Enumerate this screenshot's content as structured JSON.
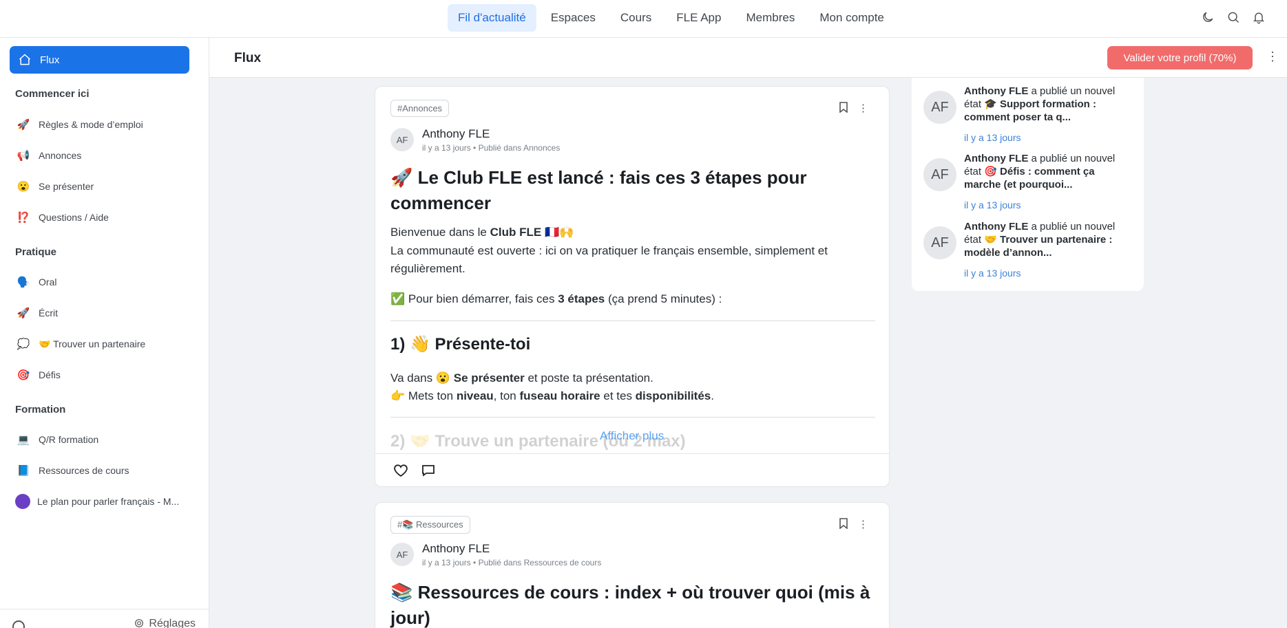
{
  "topnav": {
    "links": [
      "Fil d'actualité",
      "Espaces",
      "Cours",
      "FLE App",
      "Membres",
      "Mon compte"
    ],
    "icons": [
      "moon-icon",
      "search-icon",
      "bell-icon"
    ]
  },
  "sidebar": {
    "active": "Flux",
    "sections": {
      "start": "Commencer ici",
      "practice": "Pratique",
      "training": "Formation"
    },
    "items": [
      {
        "emoji": "🚀",
        "label": "Règles & mode d’emploi"
      },
      {
        "emoji": "📢",
        "label": "Annonces"
      },
      {
        "emoji": "😮",
        "label": "Se présenter"
      },
      {
        "emoji": "⁉️",
        "label": "Questions / Aide"
      },
      {
        "emoji": "🗣️",
        "label": "Oral"
      },
      {
        "emoji": "🚀",
        "label": "Écrit"
      },
      {
        "emoji": "💭",
        "label": "🤝 Trouver un partenaire"
      },
      {
        "emoji": "🎯",
        "label": "Défis"
      },
      {
        "emoji": "💻",
        "label": "Q/R formation"
      },
      {
        "emoji": "📘",
        "label": "Ressources de cours"
      },
      {
        "emoji": "",
        "label": "Le plan pour parler français - M..."
      }
    ],
    "footer_settings": "Réglages"
  },
  "header": {
    "title": "Flux",
    "cta": "Valider votre profil (70%)"
  },
  "posts": [
    {
      "tag": "#Annonces",
      "avatar": "AF",
      "author": "Anthony FLE",
      "meta": "il y a 13 jours • Publié dans Annonces",
      "title": "🚀 Le Club FLE est lancé : fais ces 3 étapes pour commencer",
      "welcome_prefix": "Bienvenue dans le ",
      "welcome_bold": "Club FLE",
      "welcome_suffix": " 🇫🇷🙌",
      "intro": "La communauté est ouverte : ici on va pratiquer le français ensemble, simplement et régulièrement.",
      "steps_prefix": "✅ Pour bien démarrer, fais ces ",
      "steps_bold": "3 étapes",
      "steps_suffix": " (ça prend 5 minutes) :",
      "step1_title": "1) 👋 Présente-toi",
      "step1_line1_prefix": "Va dans 😮 ",
      "step1_line1_bold": "Se présenter",
      "step1_line1_suffix": " et poste ta présentation.",
      "step1_line2_a": "👉 Mets ton ",
      "step1_line2_b": "niveau",
      "step1_line2_c": ", ton ",
      "step1_line2_d": "fuseau horaire",
      "step1_line2_e": " et tes ",
      "step1_line2_f": "disponibilités",
      "step1_line2_g": ".",
      "step2_title": "2) 🤝 Trouve un partenaire (ou 2 max)",
      "show_more": "Afficher plus"
    },
    {
      "tag": "#📚 Ressources",
      "avatar": "AF",
      "author": "Anthony FLE",
      "meta": "il y a 13 jours • Publié dans Ressources de cours",
      "title": "📚 Ressources de cours : index + où trouver quoi (mis à jour)"
    }
  ],
  "activity": [
    {
      "avatar": "AF",
      "author": "Anthony FLE",
      "action": " a publié un nouvel état ",
      "subject": "🎓 Support formation : comment poser ta q...",
      "time": "il y a 13 jours"
    },
    {
      "avatar": "AF",
      "author": "Anthony FLE",
      "action": " a publié un nouvel état ",
      "subject": "🎯 Défis : comment ça marche (et pourquoi...",
      "time": "il y a 13 jours"
    },
    {
      "avatar": "AF",
      "author": "Anthony FLE",
      "action": " a publié un nouvel état ",
      "subject": "🤝 Trouver un partenaire : modèle d’annon...",
      "time": "il y a 13 jours"
    }
  ]
}
